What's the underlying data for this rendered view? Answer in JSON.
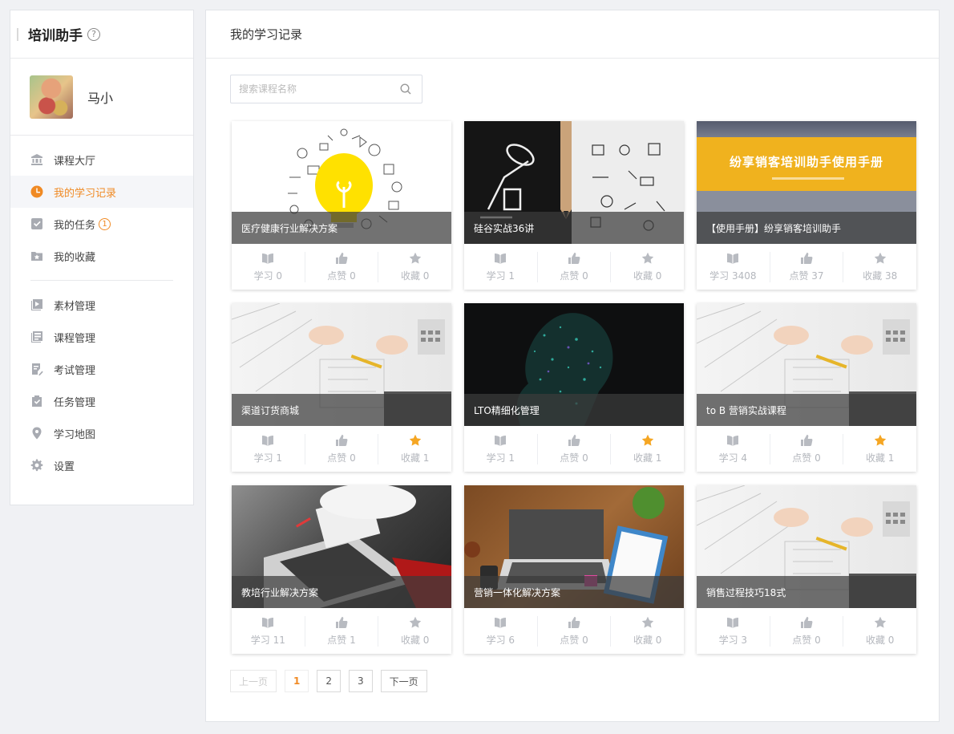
{
  "sidebar": {
    "title": "培训助手",
    "help_icon": "?",
    "user_name": "马小",
    "items": [
      {
        "label": "课程大厅",
        "icon": "bank-icon"
      },
      {
        "label": "我的学习记录",
        "icon": "clock-icon",
        "active": true
      },
      {
        "label": "我的任务",
        "icon": "check-box-icon",
        "badge": "1"
      },
      {
        "label": "我的收藏",
        "icon": "star-folder-icon"
      },
      {
        "label": "素材管理",
        "icon": "media-icon"
      },
      {
        "label": "课程管理",
        "icon": "course-list-icon"
      },
      {
        "label": "考试管理",
        "icon": "exam-icon"
      },
      {
        "label": "任务管理",
        "icon": "task-clipboard-icon"
      },
      {
        "label": "学习地图",
        "icon": "map-pin-icon"
      },
      {
        "label": "设置",
        "icon": "gear-icon"
      }
    ]
  },
  "main": {
    "title": "我的学习记录",
    "search_placeholder": "搜索课程名称",
    "cards": [
      {
        "title": "医疗健康行业解决方案",
        "learn": "学习 0",
        "like": "点赞 0",
        "fav": "收藏 0",
        "fav_on": false
      },
      {
        "title": "硅谷实战36讲",
        "learn": "学习 1",
        "like": "点赞 0",
        "fav": "收藏 0",
        "fav_on": false
      },
      {
        "title": "【使用手册】纷享销客培训助手",
        "learn": "学习 3408",
        "like": "点赞 37",
        "fav": "收藏 38",
        "fav_on": false,
        "banner": "纷享销客培训助手使用手册"
      },
      {
        "title": "渠道订货商城",
        "learn": "学习 1",
        "like": "点赞 0",
        "fav": "收藏 1",
        "fav_on": true
      },
      {
        "title": "LTO精细化管理",
        "learn": "学习 1",
        "like": "点赞 0",
        "fav": "收藏 1",
        "fav_on": true
      },
      {
        "title": "to B 营销实战课程",
        "learn": "学习 4",
        "like": "点赞 0",
        "fav": "收藏 1",
        "fav_on": true
      },
      {
        "title": "教培行业解决方案",
        "learn": "学习 11",
        "like": "点赞 1",
        "fav": "收藏 0",
        "fav_on": false
      },
      {
        "title": "营销一体化解决方案",
        "learn": "学习 6",
        "like": "点赞 0",
        "fav": "收藏 0",
        "fav_on": false
      },
      {
        "title": "销售过程技巧18式",
        "learn": "学习 3",
        "like": "点赞 0",
        "fav": "收藏 0",
        "fav_on": false
      }
    ]
  },
  "pager": {
    "prev": "上一页",
    "pages": [
      "1",
      "2",
      "3"
    ],
    "current": "1",
    "next": "下一页"
  },
  "colors": {
    "accent": "#f08a24",
    "fav_active": "#f5a623"
  }
}
